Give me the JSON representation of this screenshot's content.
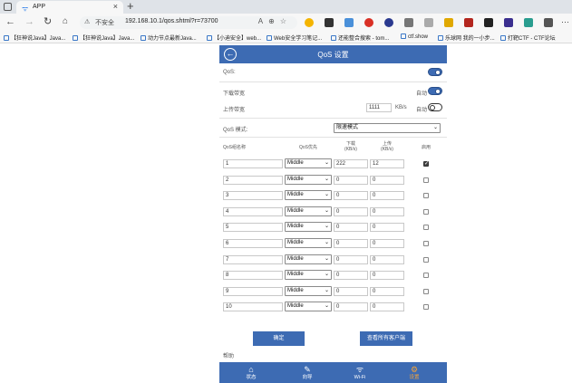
{
  "browser": {
    "tab_title": "APP",
    "security_label": "不安全",
    "url": "192.168.10.1/qos.shtml?r=73700",
    "bookmarks": [
      "【狂神说Java】Java...",
      "【狂神说Java】Java...",
      "动力节点最新Java...",
      "【小迪安全】web...",
      "Web安全学习笔记...",
      "还能整合搜索 - tom...",
      "ctf.show",
      "乐球网 我的一小步...",
      "打靶CTF - CTF论坛"
    ]
  },
  "header": {
    "title": "QoS 设置"
  },
  "qos": {
    "label": "QoS:",
    "enabled": true,
    "download_label": "下载带宽",
    "download_auto_label": "自动",
    "download_auto": true,
    "upload_label": "上传带宽",
    "upload_value": "1111",
    "upload_unit": "KB/s",
    "upload_auto_label": "自动",
    "upload_auto": false,
    "mode_label": "QoS 模式:",
    "mode_value": "限速模式"
  },
  "table": {
    "headers": {
      "name": "QoS组名称",
      "priority": "QoS优先",
      "download": "下载\n(KB/s)",
      "upload": "上传\n(KB/s)",
      "enable": "启用"
    },
    "rows": [
      {
        "name": "1",
        "priority": "Middle",
        "download": "222",
        "upload": "12",
        "enabled": true
      },
      {
        "name": "2",
        "priority": "Middle",
        "download": "0",
        "upload": "0",
        "enabled": false
      },
      {
        "name": "3",
        "priority": "Middle",
        "download": "0",
        "upload": "0",
        "enabled": false
      },
      {
        "name": "4",
        "priority": "Middle",
        "download": "0",
        "upload": "0",
        "enabled": false
      },
      {
        "name": "5",
        "priority": "Middle",
        "download": "0",
        "upload": "0",
        "enabled": false
      },
      {
        "name": "6",
        "priority": "Middle",
        "download": "0",
        "upload": "0",
        "enabled": false
      },
      {
        "name": "7",
        "priority": "Middle",
        "download": "0",
        "upload": "0",
        "enabled": false
      },
      {
        "name": "8",
        "priority": "Middle",
        "download": "0",
        "upload": "0",
        "enabled": false
      },
      {
        "name": "9",
        "priority": "Middle",
        "download": "0",
        "upload": "0",
        "enabled": false
      },
      {
        "name": "10",
        "priority": "Middle",
        "download": "0",
        "upload": "0",
        "enabled": false
      }
    ]
  },
  "buttons": {
    "confirm": "确定",
    "view_clients": "查看所有客户端"
  },
  "help_label": "帮助",
  "bottom_nav": [
    {
      "label": "状态",
      "icon": "home-icon",
      "active": false
    },
    {
      "label": "向导",
      "icon": "wand-icon",
      "active": false
    },
    {
      "label": "Wi-Fi",
      "icon": "wifi-icon",
      "active": false
    },
    {
      "label": "设置",
      "icon": "gear-icon",
      "active": true
    }
  ],
  "colors": {
    "primary": "#3d6bb3",
    "active_nav": "#f2a23a"
  }
}
